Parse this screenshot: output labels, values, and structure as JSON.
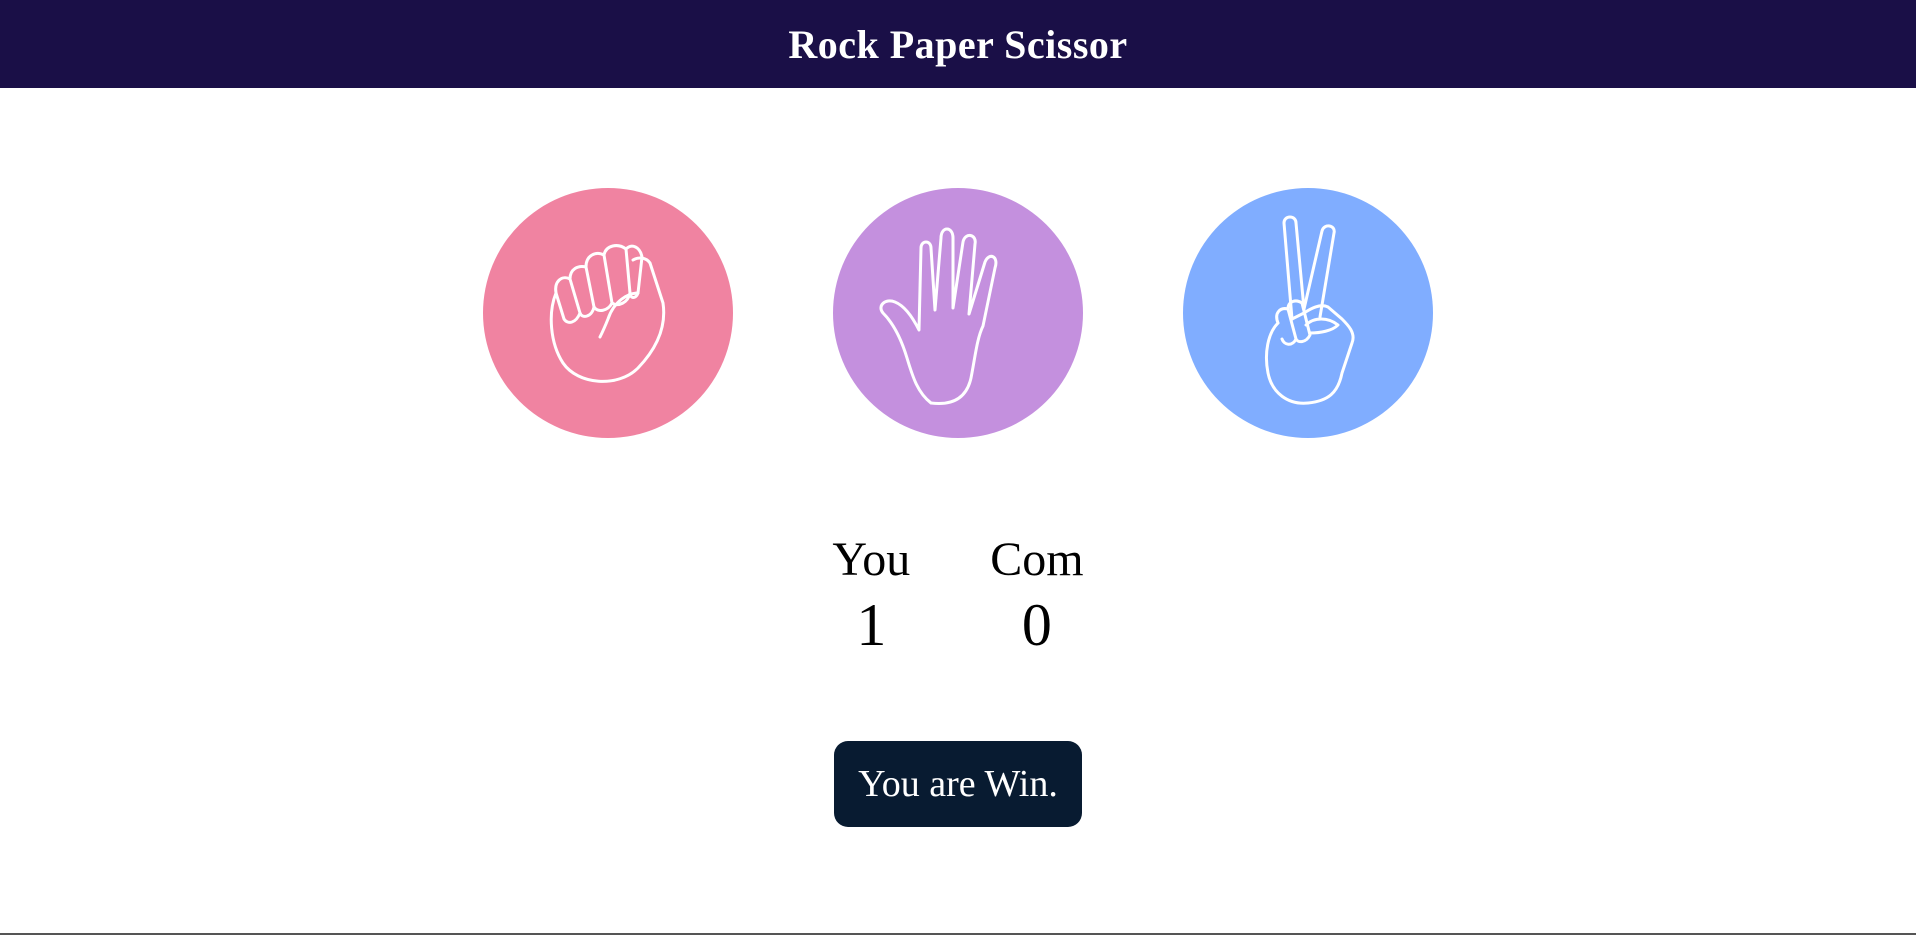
{
  "header": {
    "title": "Rock Paper Scissor"
  },
  "choices": [
    {
      "id": "rock",
      "icon": "rock-hand-icon",
      "color": "#f083a1"
    },
    {
      "id": "paper",
      "icon": "paper-hand-icon",
      "color": "#c490de"
    },
    {
      "id": "scissors",
      "icon": "scissors-hand-icon",
      "color": "#80adff"
    }
  ],
  "score": {
    "user_label": "You",
    "user_value": "1",
    "computer_label": "Com",
    "computer_value": "0"
  },
  "message": {
    "text": "You are Win.",
    "background": "#081b31"
  },
  "colors": {
    "header_bg": "#1a0f47"
  }
}
